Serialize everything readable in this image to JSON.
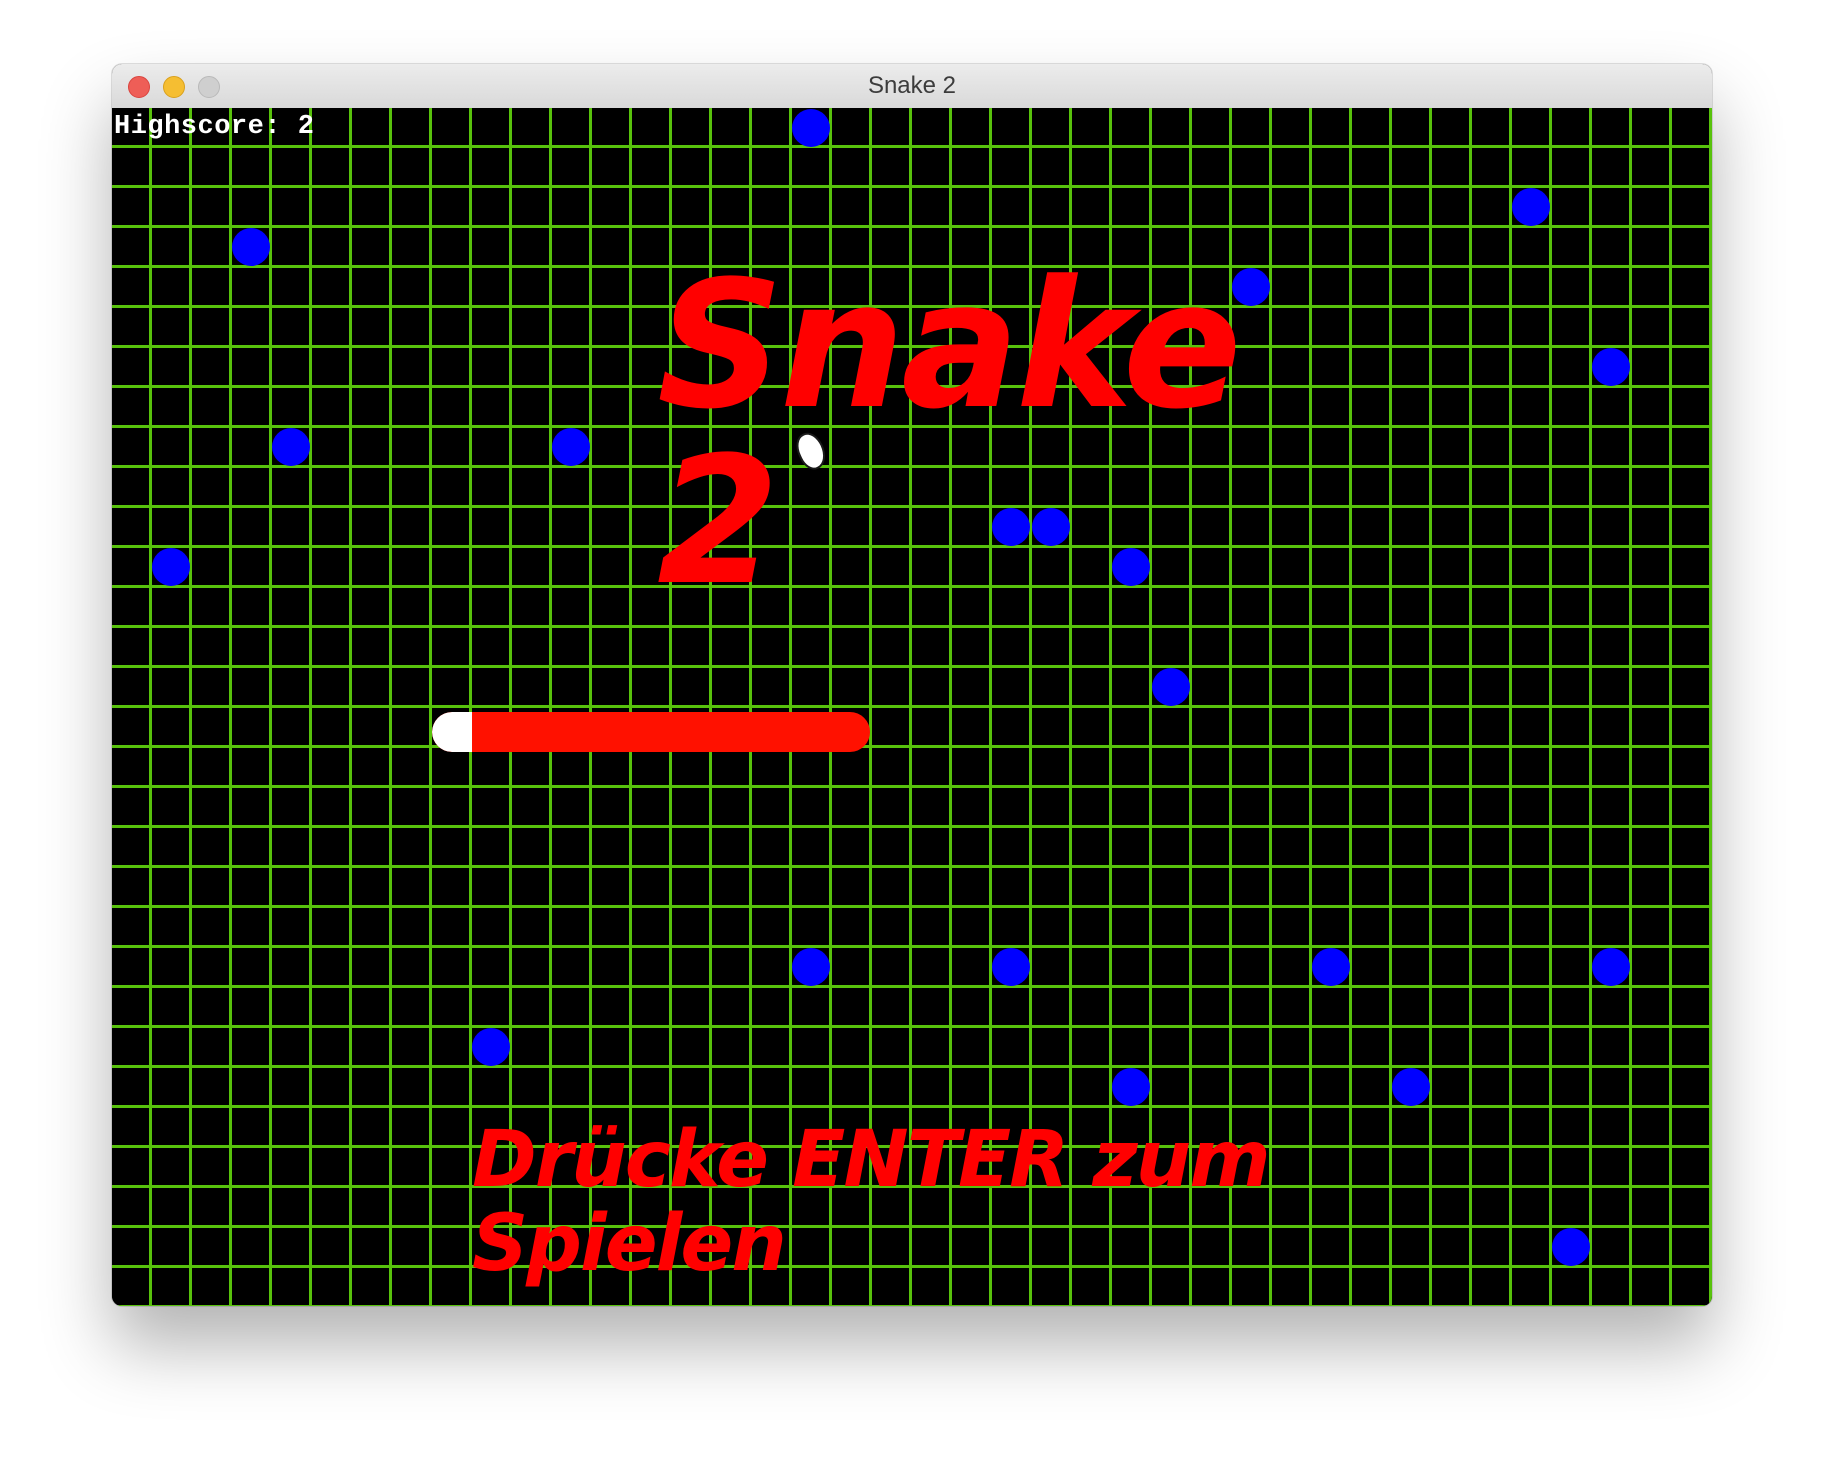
{
  "window": {
    "title": "Snake 2"
  },
  "hud": {
    "highscore": "Highscore: 2"
  },
  "game": {
    "title": "Snake 2",
    "prompt": "Drücke ENTER zum Spielen"
  },
  "colors": {
    "background": "#000000",
    "grid": "#58c20c",
    "food": "#0000ff",
    "snake_body": "#ff1100",
    "snake_head": "#ffffff",
    "text_accent": "#ff0000"
  }
}
